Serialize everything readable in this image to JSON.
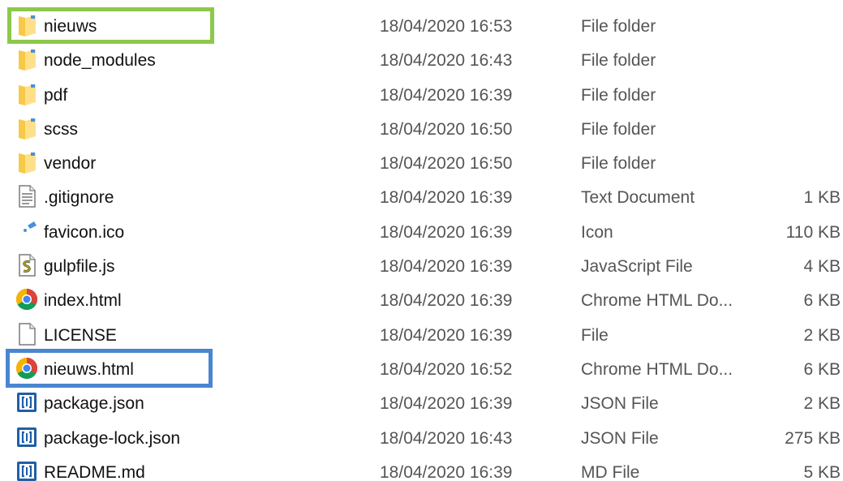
{
  "files": [
    {
      "name": "nieuws",
      "date": "18/04/2020 16:53",
      "type": "File folder",
      "size": "",
      "icon": "folder-icon"
    },
    {
      "name": "node_modules",
      "date": "18/04/2020 16:43",
      "type": "File folder",
      "size": "",
      "icon": "folder-icon"
    },
    {
      "name": "pdf",
      "date": "18/04/2020 16:39",
      "type": "File folder",
      "size": "",
      "icon": "folder-icon"
    },
    {
      "name": "scss",
      "date": "18/04/2020 16:50",
      "type": "File folder",
      "size": "",
      "icon": "folder-icon"
    },
    {
      "name": "vendor",
      "date": "18/04/2020 16:50",
      "type": "File folder",
      "size": "",
      "icon": "folder-icon"
    },
    {
      "name": ".gitignore",
      "date": "18/04/2020 16:39",
      "type": "Text Document",
      "size": "1 KB",
      "icon": "text-document-icon"
    },
    {
      "name": "favicon.ico",
      "date": "18/04/2020 16:39",
      "type": "Icon",
      "size": "110 KB",
      "icon": "favicon-icon"
    },
    {
      "name": "gulpfile.js",
      "date": "18/04/2020 16:39",
      "type": "JavaScript File",
      "size": "4 KB",
      "icon": "javascript-file-icon"
    },
    {
      "name": "index.html",
      "date": "18/04/2020 16:39",
      "type": "Chrome HTML Do...",
      "size": "6 KB",
      "icon": "chrome-icon"
    },
    {
      "name": "LICENSE",
      "date": "18/04/2020 16:39",
      "type": "File",
      "size": "2 KB",
      "icon": "blank-file-icon"
    },
    {
      "name": "nieuws.html",
      "date": "18/04/2020 16:52",
      "type": "Chrome HTML Do...",
      "size": "6 KB",
      "icon": "chrome-icon"
    },
    {
      "name": "package.json",
      "date": "18/04/2020 16:39",
      "type": "JSON File",
      "size": "2 KB",
      "icon": "json-file-icon"
    },
    {
      "name": "package-lock.json",
      "date": "18/04/2020 16:43",
      "type": "JSON File",
      "size": "275 KB",
      "icon": "json-file-icon"
    },
    {
      "name": "README.md",
      "date": "18/04/2020 16:39",
      "type": "MD File",
      "size": "5 KB",
      "icon": "json-file-icon"
    }
  ],
  "highlights": {
    "green_color": "#8cc84b",
    "blue_color": "#4a86cf"
  }
}
